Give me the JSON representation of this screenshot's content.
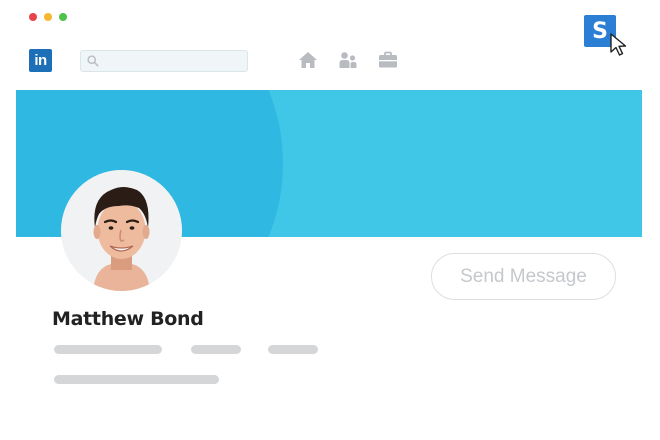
{
  "colors": {
    "dot_red": "#e8424c",
    "dot_yellow": "#f5b731",
    "dot_green": "#4ec24a",
    "brand_blue": "#2a7fd4",
    "linkedin_blue": "#1d6fb8",
    "banner_light": "#40c6e7",
    "banner_dark": "#2fb8e2",
    "nav_icon_gray": "#b8bcc0",
    "search_bg": "#f0f6f8",
    "placeholder_gray": "#d4d6d8",
    "button_text": "#c5c8cc"
  },
  "browser": {
    "dots": [
      "close",
      "minimize",
      "maximize"
    ]
  },
  "extension": {
    "letter": "S",
    "icon": "s-extension-icon"
  },
  "navbar": {
    "logo_text": "in",
    "search_placeholder": "",
    "icons": [
      "home-icon",
      "people-icon",
      "briefcase-icon"
    ]
  },
  "profile": {
    "name": "Matthew Bond",
    "action_label": "Send Message"
  }
}
